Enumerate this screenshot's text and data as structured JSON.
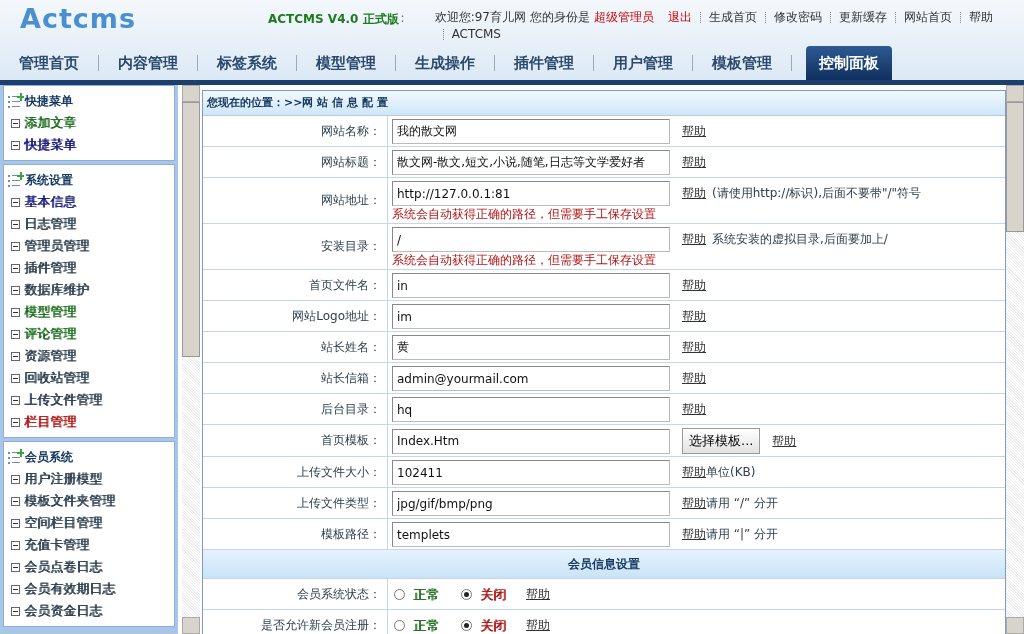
{
  "header": {
    "logo": "Actcms",
    "version": "ACTCMS V4.0 正式版",
    "version_sep": ":",
    "welcome": "欢迎您:97育儿网 您的身份是",
    "role": "超级管理员",
    "logout": "退出",
    "links": [
      "生成首页",
      "修改密码",
      "更新缓存",
      "网站首页",
      "帮助",
      "ACTCMS"
    ]
  },
  "tabs": [
    {
      "label": "管理首页",
      "selected": false
    },
    {
      "label": "内容管理",
      "selected": false
    },
    {
      "label": "标签系统",
      "selected": false
    },
    {
      "label": "模型管理",
      "selected": false
    },
    {
      "label": "生成操作",
      "selected": false
    },
    {
      "label": "插件管理",
      "selected": false
    },
    {
      "label": "用户管理",
      "selected": false
    },
    {
      "label": "模板管理",
      "selected": false
    },
    {
      "label": "控制面板",
      "selected": true
    }
  ],
  "sidebar": {
    "groups": [
      {
        "title": "快捷菜单",
        "items": [
          {
            "label": "添加文章",
            "color": "#1f6e1f"
          },
          {
            "label": "快捷菜单",
            "color": "#1a1a7a"
          }
        ]
      },
      {
        "title": "系统设置",
        "items": [
          {
            "label": "基本信息",
            "color": "#1a1a7a"
          },
          {
            "label": "日志管理",
            "color": "#2f4050"
          },
          {
            "label": "管理员管理",
            "color": "#2f4050"
          },
          {
            "label": "插件管理",
            "color": "#2f4050"
          },
          {
            "label": "数据库维护",
            "color": "#2f4050"
          },
          {
            "label": "模型管理",
            "color": "#1f6e1f"
          },
          {
            "label": "评论管理",
            "color": "#1f6e1f"
          },
          {
            "label": "资源管理",
            "color": "#2f4050"
          },
          {
            "label": "回收站管理",
            "color": "#2f4050"
          },
          {
            "label": "上传文件管理",
            "color": "#2f4050"
          },
          {
            "label": "栏目管理",
            "color": "#b01515"
          }
        ]
      },
      {
        "title": "会员系统",
        "items": [
          {
            "label": "用户注册模型",
            "color": "#2f4050"
          },
          {
            "label": "模板文件夹管理",
            "color": "#2f4050"
          },
          {
            "label": "空间栏目管理",
            "color": "#2f4050"
          },
          {
            "label": "充值卡管理",
            "color": "#2f4050"
          },
          {
            "label": "会员点卷日志",
            "color": "#2f4050"
          },
          {
            "label": "会员有效期日志",
            "color": "#2f4050"
          },
          {
            "label": "会员资金日志",
            "color": "#2f4050"
          }
        ]
      }
    ]
  },
  "breadcrumb": "您现在的位置：>>网 站 信 息 配 置",
  "rows": [
    {
      "kind": "text",
      "label": "网站名称：",
      "value": "我的散文网",
      "help": "帮助"
    },
    {
      "kind": "text",
      "label": "网站标题：",
      "value": "散文网-散文,短文,小说,随笔,日志等文学爱好者",
      "help": "帮助"
    },
    {
      "kind": "text",
      "label": "网站地址：",
      "value": "http://127.0.0.1:81",
      "note": "系统会自动获得正确的路径，但需要手工保存设置",
      "help": "帮助",
      "hint": "(请使用http://标识),后面不要带\"/\"符号"
    },
    {
      "kind": "text",
      "label": "安装目录：",
      "value": "/",
      "note": "系统会自动获得正确的路径，但需要手工保存设置",
      "help": "帮助",
      "hint": "系统安装的虚拟目录,后面要加上/"
    },
    {
      "kind": "text",
      "label": "首页文件名：",
      "value": "in",
      "help": "帮助"
    },
    {
      "kind": "text",
      "label": "网站Logo地址：",
      "value": "im",
      "help": "帮助"
    },
    {
      "kind": "text",
      "label": "站长姓名：",
      "value": "黄",
      "help": "帮助"
    },
    {
      "kind": "text",
      "label": "站长信箱：",
      "value": "admin@yourmail.com",
      "help": "帮助"
    },
    {
      "kind": "text",
      "label": "后台目录：",
      "value": "hq",
      "help": "帮助"
    },
    {
      "kind": "text",
      "label": "首页模板：",
      "value": "Index.Htm",
      "button": "选择模板...",
      "help": "帮助"
    },
    {
      "kind": "text",
      "label": "上传文件大小：",
      "value": "102411",
      "help": "帮助",
      "hint": "单位(KB)",
      "hint_tight": true
    },
    {
      "kind": "text",
      "label": "上传文件类型：",
      "value": "jpg/gif/bmp/png",
      "help": "帮助",
      "hint": "请用 “/” 分开",
      "hint_tight": true
    },
    {
      "kind": "text",
      "label": "模板路径：",
      "value": "templets",
      "help": "帮助",
      "hint": "请用 “|” 分开",
      "hint_tight": true
    },
    {
      "kind": "section",
      "label": "会员信息设置"
    },
    {
      "kind": "radio",
      "label": "会员系统状态：",
      "options": [
        {
          "label": "正常",
          "selected": false,
          "color": "#1f6e1f"
        },
        {
          "label": "关闭",
          "selected": true,
          "color": "#b01515"
        }
      ],
      "help": "帮助"
    },
    {
      "kind": "radio",
      "label": "是否允许新会员注册：",
      "options": [
        {
          "label": "正常",
          "selected": false,
          "color": "#1f6e1f"
        },
        {
          "label": "关闭",
          "selected": true,
          "color": "#b01515"
        }
      ],
      "help": "帮助"
    }
  ]
}
